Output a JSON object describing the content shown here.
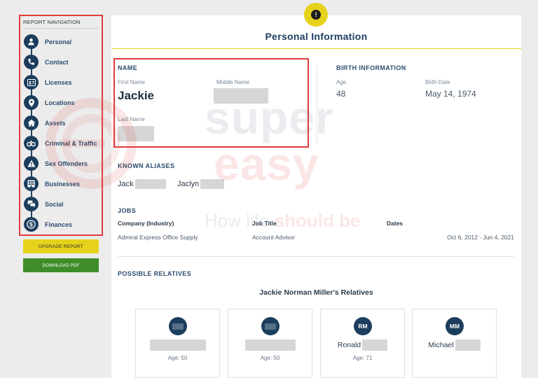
{
  "sidebar": {
    "heading": "REPORT NAVIGATION",
    "items": [
      {
        "label": "Personal",
        "icon": "person-icon"
      },
      {
        "label": "Contact",
        "icon": "phone-icon"
      },
      {
        "label": "Licenses",
        "icon": "id-card-icon"
      },
      {
        "label": "Locations",
        "icon": "map-pin-icon"
      },
      {
        "label": "Assets",
        "icon": "home-icon"
      },
      {
        "label": "Criminal & Traffic",
        "icon": "handcuffs-icon"
      },
      {
        "label": "Sex Offenders",
        "icon": "warning-icon"
      },
      {
        "label": "Businesses",
        "icon": "building-icon"
      },
      {
        "label": "Social",
        "icon": "chat-icon"
      },
      {
        "label": "Finances",
        "icon": "dollar-icon"
      }
    ],
    "upgrade_label": "UPGRADE REPORT",
    "download_label": "DOWNLOAD PDF"
  },
  "main": {
    "title": "Personal Information",
    "name": {
      "section_title": "NAME",
      "first_name_label": "First Name",
      "first_name_value": "Jackie",
      "middle_name_label": "Middle Name",
      "last_name_label": "Last Name"
    },
    "birth": {
      "section_title": "BIRTH INFORMATION",
      "age_label": "Age",
      "age_value": "48",
      "birth_date_label": "Birth Date",
      "birth_date_value": "May 14, 1974"
    },
    "aliases": {
      "section_title": "KNOWN ALIASES",
      "items": [
        "Jack",
        "Jaclyn"
      ]
    },
    "jobs": {
      "section_title": "JOBS",
      "headers": [
        "Company (Industry)",
        "Job Title",
        "Dates"
      ],
      "rows": [
        [
          "Admiral Express Office Supply",
          "Account Advisor",
          "Oct 6, 2012 - Jun 4, 2021"
        ]
      ]
    },
    "relatives": {
      "section_title": "POSSIBLE RELATIVES",
      "heading": "Jackie Norman Miller's Relatives",
      "cards": [
        {
          "initials": "",
          "name": "",
          "age": "Age: 50"
        },
        {
          "initials": "",
          "name": "",
          "age": "Age: 50"
        },
        {
          "initials": "RM",
          "name": "Ronald",
          "age": "Age: 71"
        },
        {
          "initials": "MM",
          "name": "Michael",
          "age": ""
        }
      ]
    }
  },
  "watermark": {
    "word1": "super",
    "word2": "easy",
    "tagline_a": "How life ",
    "tagline_b": "should be"
  },
  "colors": {
    "navy": "#1c3d5c",
    "yellow": "#e6d21c",
    "green": "#3f8d2a",
    "highlight_red": "#e23b3b"
  }
}
